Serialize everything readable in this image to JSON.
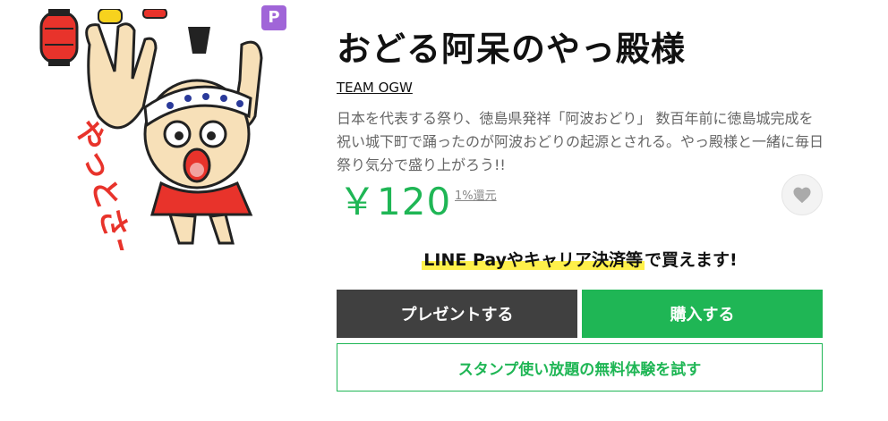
{
  "product": {
    "title": "おどる阿呆のやっ殿様",
    "author": "TEAM OGW",
    "description": "日本を代表する祭り、徳島県発祥「阿波おどり」 数百年前に徳島城完成を祝い城下町で踊ったのが阿波おどりの起源とされる。やっ殿様と一緒に毎日祭り気分で盛り上がろう!!",
    "price": "￥120",
    "rebate": "1%還元",
    "badge": "P",
    "sticker_text": "やっとさー"
  },
  "promo": {
    "highlight": "LINE Payやキャリア決済等",
    "rest": "で買えます!"
  },
  "buttons": {
    "present": "プレゼントする",
    "buy": "購入する",
    "trial": "スタンプ使い放題の無料体験を試す"
  },
  "colors": {
    "accent_green": "#1fb655",
    "dark_button": "#404040",
    "badge_purple": "#a065d8",
    "highlight_yellow": "#fff04a"
  },
  "icons": {
    "favorite": "heart-icon",
    "premium": "p-badge-icon"
  }
}
